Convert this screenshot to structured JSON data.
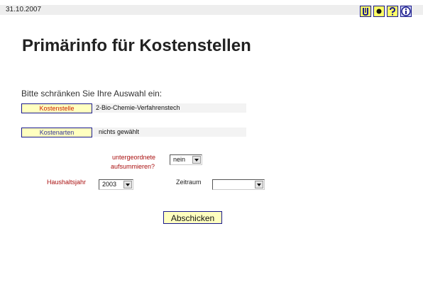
{
  "header": {
    "date": "31.10.2007",
    "icons": [
      {
        "name": "folder-icon",
        "glyph": "U"
      },
      {
        "name": "dot-icon",
        "glyph": "●"
      },
      {
        "name": "help-icon",
        "glyph": "?"
      },
      {
        "name": "info-icon",
        "glyph": "i"
      }
    ]
  },
  "page": {
    "title": "Primärinfo für Kostenstellen",
    "prompt": "Bitte schränken Sie Ihre Auswahl ein:"
  },
  "filters": {
    "kostenstelle": {
      "button": "Kostenstelle",
      "value": "2-Bio-Chemie-Verfahrenstech"
    },
    "kostenarten": {
      "button": "Kostenarten",
      "value": "nichts gewählt"
    }
  },
  "options": {
    "untergeordnete_label_1": "untergeordnete",
    "untergeordnete_label_2": "aufsummieren?",
    "untergeordnete_value": "nein",
    "haushaltsjahr_label": "Haushaltsjahr",
    "haushaltsjahr_value": "2003",
    "zeitraum_label": "Zeitraum",
    "zeitraum_value": ""
  },
  "actions": {
    "submit": "Abschicken"
  },
  "colors": {
    "accent_yellow": "#ffffc0",
    "border_blue": "#1a1a8c",
    "label_red": "#aa1111"
  }
}
